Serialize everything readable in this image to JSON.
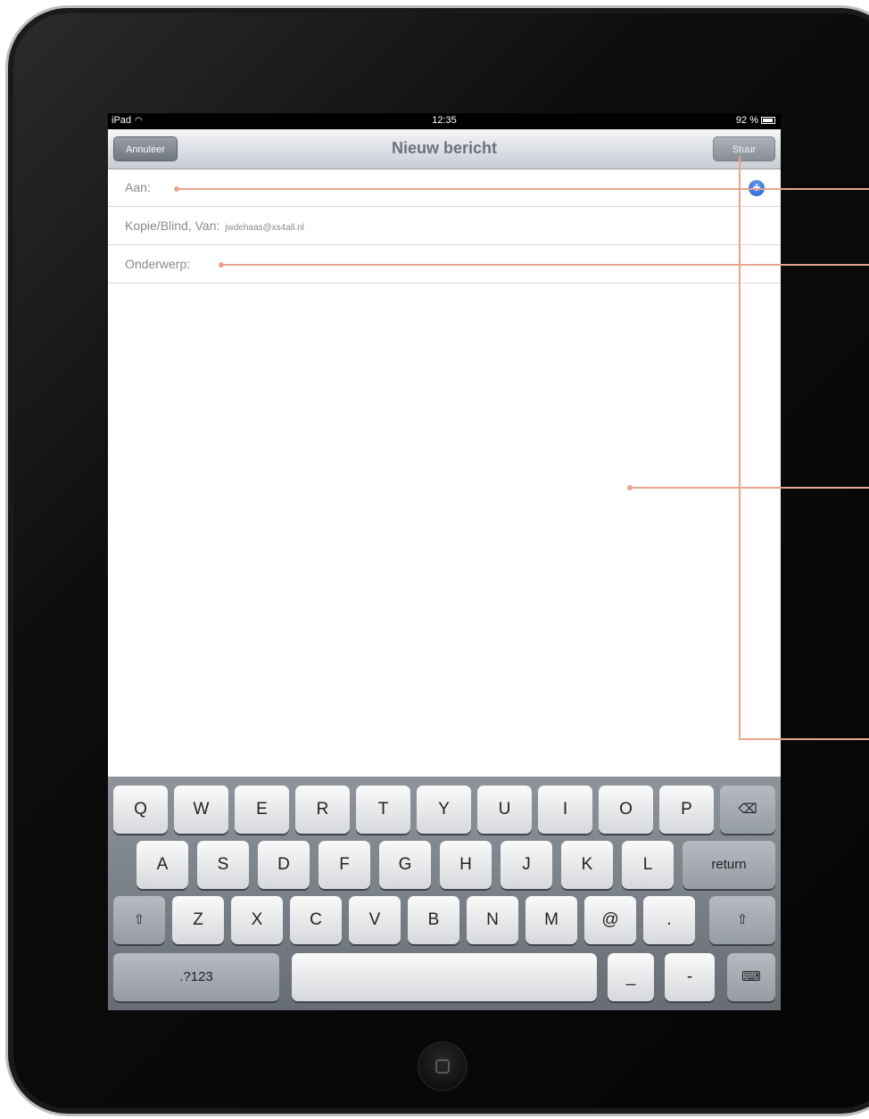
{
  "status_bar": {
    "carrier": "iPad",
    "time": "12:35",
    "battery": "92 %"
  },
  "nav": {
    "cancel": "Annuleer",
    "title": "Nieuw bericht",
    "send": "Stuur"
  },
  "fields": {
    "to_label": "Aan:",
    "cc_label": "Kopie/Blind, Van:",
    "from_value": "jwdehaas@xs4all.nl",
    "subject_label": "Onderwerp:"
  },
  "keyboard": {
    "row1": [
      "Q",
      "W",
      "E",
      "R",
      "T",
      "Y",
      "U",
      "I",
      "O",
      "P"
    ],
    "row2": [
      "A",
      "S",
      "D",
      "F",
      "G",
      "H",
      "J",
      "K",
      "L"
    ],
    "return": "return",
    "row3": [
      "Z",
      "X",
      "C",
      "V",
      "B",
      "N",
      "M",
      "@",
      "."
    ],
    "numbers": ".?123",
    "underscore": "_",
    "dash": "-"
  },
  "colors": {
    "callout": "#e8a48e",
    "add_button": "#1d5bd1"
  }
}
